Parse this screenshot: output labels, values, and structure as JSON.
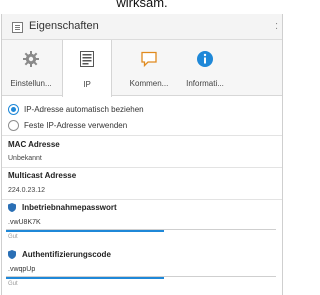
{
  "top_caption": "wirksam.",
  "window": {
    "title": "Eigenschaften",
    "menu_glyph": ":"
  },
  "tabs": [
    {
      "label": "Einstellun...",
      "icon": "gear-icon"
    },
    {
      "label": "IP",
      "icon": "document-list-icon",
      "active": true
    },
    {
      "label": "Kommen...",
      "icon": "comment-icon"
    },
    {
      "label": "Informati...",
      "icon": "info-icon"
    }
  ],
  "ip_mode": {
    "auto_label": "IP-Adresse automatisch beziehen",
    "fixed_label": "Feste IP-Adresse verwenden",
    "selected": "auto"
  },
  "mac": {
    "label": "MAC Adresse",
    "value": "Unbekannt"
  },
  "multicast": {
    "label": "Multicast Adresse",
    "value": "224.0.23.12"
  },
  "commissioning_password": {
    "label": "Inbetriebnahmepasswort",
    "value": ".vwU8K7K",
    "strength": "Gut"
  },
  "auth_code": {
    "label": "Authentifizierungscode",
    "value": ".vwqpUp",
    "strength": "Gut"
  },
  "colors": {
    "accent": "#1f88d8",
    "shield": "#2a6fb5"
  }
}
